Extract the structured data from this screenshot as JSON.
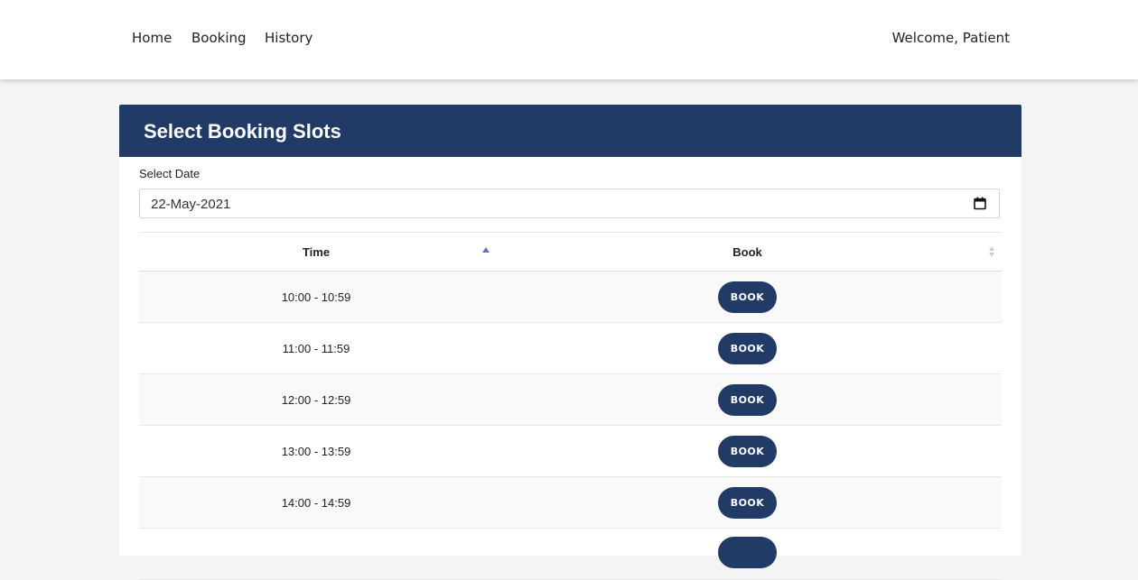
{
  "nav": {
    "links": [
      "Home",
      "Booking",
      "History"
    ],
    "welcome": "Welcome, Patient"
  },
  "card": {
    "title": "Select Booking Slots",
    "date_label": "Select Date",
    "date_value": "22-May-2021"
  },
  "table": {
    "headers": [
      "Time",
      "Book"
    ],
    "sort": {
      "column": "Time",
      "direction": "ascending"
    },
    "rows": [
      {
        "time": "10:00 - 10:59",
        "action": "BOOK"
      },
      {
        "time": "11:00 - 11:59",
        "action": "BOOK"
      },
      {
        "time": "12:00 - 12:59",
        "action": "BOOK"
      },
      {
        "time": "13:00 - 13:59",
        "action": "BOOK"
      },
      {
        "time": "14:00 - 14:59",
        "action": "BOOK"
      },
      {
        "time": "",
        "action": ""
      }
    ]
  },
  "colors": {
    "brand": "#223a66",
    "sort_active": "#5b74c9"
  },
  "icons": {
    "date_picker": "calendar-icon",
    "sort_asc": "sort-asc-icon",
    "sort_both": "sort-icon"
  }
}
